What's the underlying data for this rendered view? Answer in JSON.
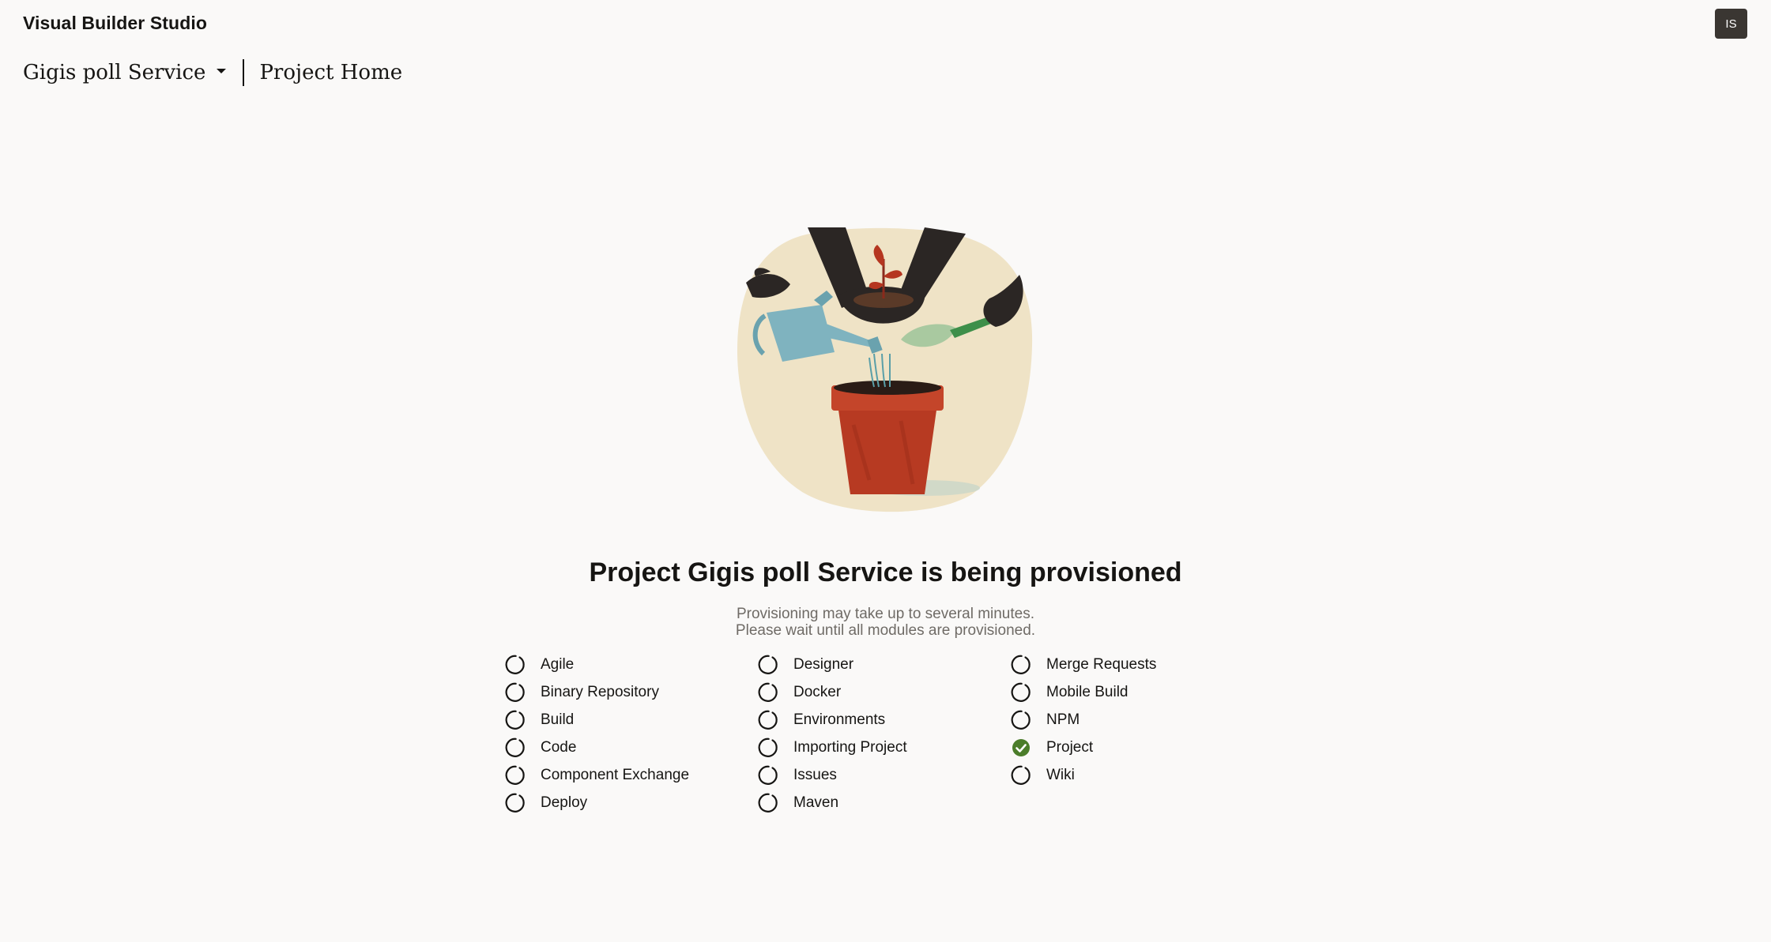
{
  "app": {
    "title": "Visual Builder Studio",
    "user_initials": "IS"
  },
  "breadcrumb": {
    "project_name": "Gigis poll Service",
    "page": "Project Home"
  },
  "status": {
    "headline": "Project Gigis poll Service is being provisioned",
    "line1": "Provisioning may take up to several minutes.",
    "line2": "Please wait until all modules are provisioned."
  },
  "modules": [
    {
      "label": "Agile",
      "state": "loading"
    },
    {
      "label": "Binary Repository",
      "state": "loading"
    },
    {
      "label": "Build",
      "state": "loading"
    },
    {
      "label": "Code",
      "state": "loading"
    },
    {
      "label": "Component Exchange",
      "state": "loading"
    },
    {
      "label": "Deploy",
      "state": "loading"
    },
    {
      "label": "Designer",
      "state": "loading"
    },
    {
      "label": "Docker",
      "state": "loading"
    },
    {
      "label": "Environments",
      "state": "loading"
    },
    {
      "label": "Importing Project",
      "state": "loading"
    },
    {
      "label": "Issues",
      "state": "loading"
    },
    {
      "label": "Maven",
      "state": "loading"
    },
    {
      "label": "Merge Requests",
      "state": "loading"
    },
    {
      "label": "Mobile Build",
      "state": "loading"
    },
    {
      "label": "NPM",
      "state": "loading"
    },
    {
      "label": "Project",
      "state": "done"
    },
    {
      "label": "Wiki",
      "state": "loading"
    }
  ],
  "icons": {
    "loading": "spinner-icon",
    "done": "check-circle-icon"
  },
  "colors": {
    "background": "#faf9f8",
    "text": "#161513",
    "muted_text": "#6f6b66",
    "avatar_bg": "#3a3632",
    "success": "#4b7d2a"
  }
}
